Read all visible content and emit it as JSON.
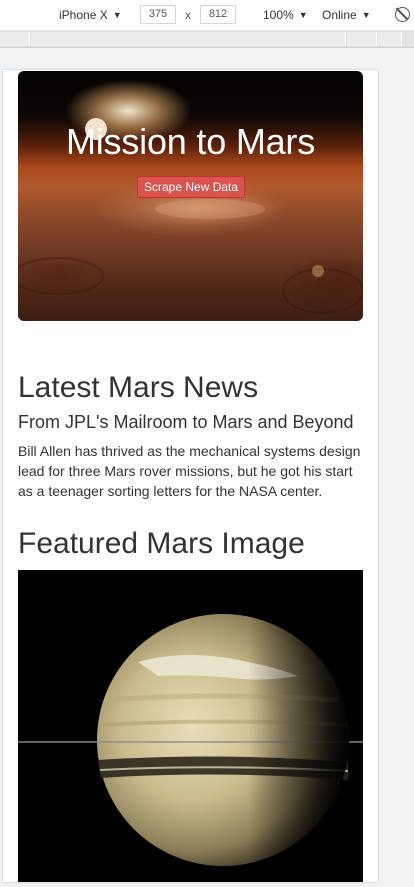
{
  "devtools": {
    "device": "iPhone X",
    "width": "375",
    "times": "x",
    "height": "812",
    "zoom": "100%",
    "network": "Online",
    "caret": "▼"
  },
  "jumbotron": {
    "title": "Mission to Mars",
    "button_label": "Scrape New Data"
  },
  "news": {
    "section_title": "Latest Mars News",
    "headline": "From JPL's Mailroom to Mars and Beyond",
    "paragraph": "Bill Allen has thrived as the mechanical systems design lead for three Mars rover missions, but he got his start as a teenager sorting letters for the NASA center."
  },
  "featured": {
    "section_title": "Featured Mars Image"
  }
}
